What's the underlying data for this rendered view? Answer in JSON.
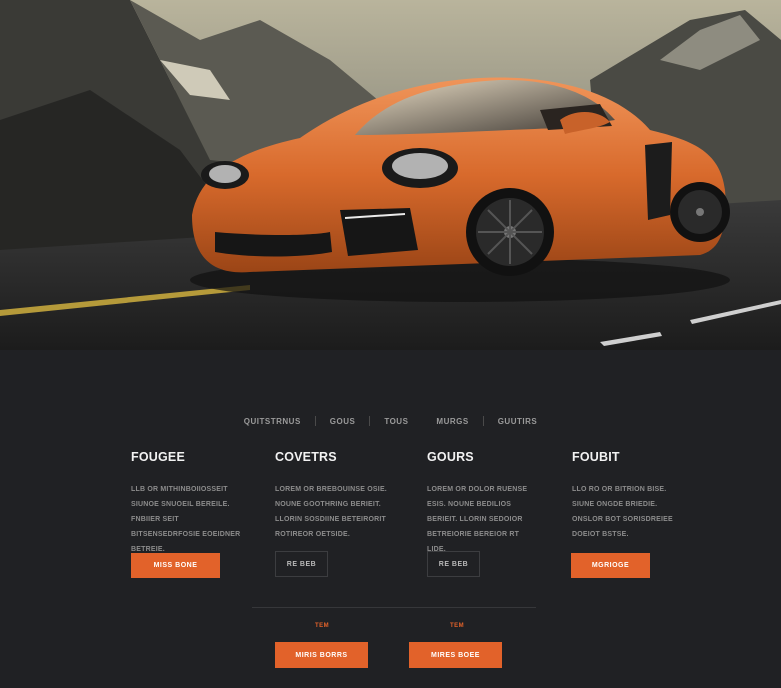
{
  "colors": {
    "accent": "#e2622a",
    "background": "#202124",
    "car": "#e07a3c"
  },
  "hero": {
    "image": "orange-sports-car-mountain-road"
  },
  "subnav": {
    "items": [
      "QUITSTRNUS",
      "GOUS",
      "TOUS",
      "MURGS",
      "GUUTIRS"
    ]
  },
  "columns": [
    {
      "title": "FOUGEE",
      "text": "LLB OR MITHINBOIIOSSEIT SIUNOE SNUOEIL BEREILE. FNBIIER SEIT BITSENSEDRFOSIE EOEIDNER BETREIE.",
      "button": "MISS BONE",
      "button_style": "primary"
    },
    {
      "title": "COVETRS",
      "text": "LOREM OR BREBOUINSE OSIE. NOUNE GOOTHRING BERIEIT. LLORIN SOSDIINE BETEIRORIT ROTIREOR OETSIDE.",
      "button": "RE BEB",
      "button_style": "ghost"
    },
    {
      "title": "GOURS",
      "text": "LOREM OR DOLOR RUENSE ESIS. NOUNE BEDILIOS BERIEIT. LLORIN SEDOIOR BETREIORIE BEREIOR RT LIDE.",
      "button": "RE BEB",
      "button_style": "ghost"
    },
    {
      "title": "FOUBIT",
      "text": "LLO RO OR BITRION BISE. SIUNE ONGDE BRIEDIE. ONSLOR BOT SORISDREIEE DOEIOT BSTSE.",
      "button": "MGRIOGE",
      "button_style": "primary"
    }
  ],
  "bottom": {
    "labels": [
      "TEM",
      "TEM"
    ],
    "buttons": [
      "MIRIS BORRS",
      "MIRES BOEE"
    ]
  }
}
